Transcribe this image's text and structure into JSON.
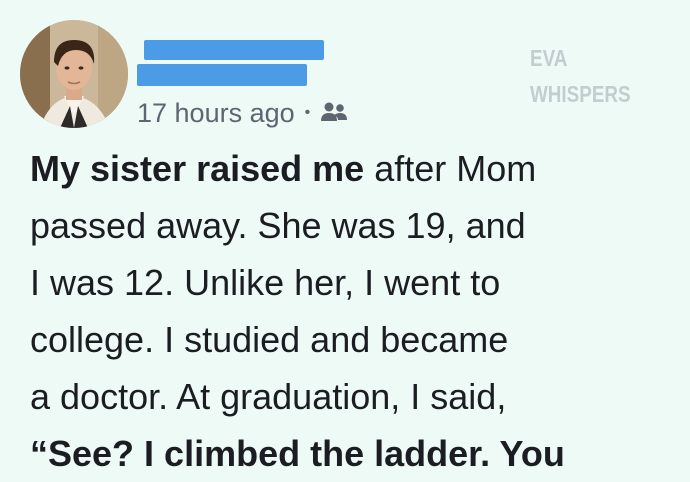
{
  "post": {
    "timestamp": "17 hours ago",
    "separator": "•",
    "audience_icon": "friends-icon",
    "lines": {
      "l1_bold": "My sister raised me",
      "l1_rest": " after Mom",
      "l2": "passed away. She was 19, and",
      "l3": "I was 12. Unlike her, I went to",
      "l4": "college. I studied and became",
      "l5": "a doctor. At graduation, I said,",
      "l6_bold": "“See? I climbed the ladder. You"
    }
  },
  "watermark": {
    "line1": "EVA",
    "line2": "WHISPERS"
  },
  "colors": {
    "background": "#eefaf5",
    "redaction": "#4b9be6",
    "meta_text": "#5e6470",
    "watermark": "#c3cdd0"
  }
}
